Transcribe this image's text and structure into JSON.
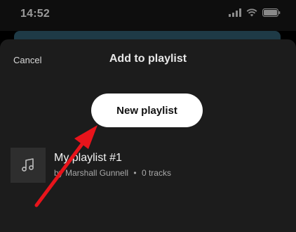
{
  "status_bar": {
    "time": "14:52",
    "icons": [
      "cellular-signal-icon",
      "wifi-icon",
      "battery-icon"
    ]
  },
  "sheet": {
    "cancel_label": "Cancel",
    "title": "Add to playlist",
    "new_playlist_label": "New playlist"
  },
  "playlists": [
    {
      "title": "My playlist #1",
      "owner": "by Marshall Gunnell",
      "separator": "•",
      "tracks": "0 tracks",
      "cover_icon": "music-note-icon"
    }
  ],
  "annotation": {
    "arrow_color": "#e8141b"
  }
}
